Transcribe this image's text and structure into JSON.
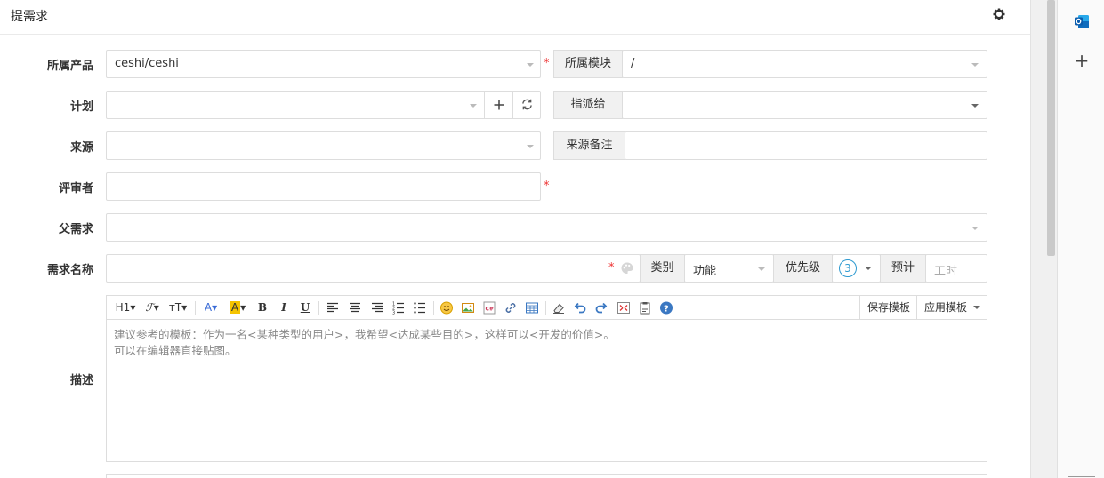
{
  "header": {
    "title": "提需求"
  },
  "form": {
    "product": {
      "label": "所属产品",
      "value": "ceshi/ceshi"
    },
    "module": {
      "label": "所属模块",
      "value": "/"
    },
    "plan": {
      "label": "计划",
      "value": ""
    },
    "assigned": {
      "label": "指派给",
      "value": ""
    },
    "source": {
      "label": "来源",
      "value": ""
    },
    "source_note": {
      "label": "来源备注",
      "value": ""
    },
    "reviewer": {
      "label": "评审者",
      "value": ""
    },
    "parent": {
      "label": "父需求",
      "value": ""
    },
    "name": {
      "label": "需求名称",
      "value": ""
    },
    "category": {
      "label": "类别",
      "value": "功能"
    },
    "priority": {
      "label": "优先级",
      "value": "3"
    },
    "estimate": {
      "label": "预计",
      "placeholder": "工时"
    },
    "required_mark": "*",
    "desc": {
      "label": "描述",
      "placeholder_line1": "建议参考的模板：作为一名<某种类型的用户>，我希望<达成某些目的>，这样可以<开发的价值>。",
      "placeholder_line2": "可以在编辑器直接贴图。"
    }
  },
  "toolbar": {
    "heading": "H1",
    "save_template": "保存模板",
    "apply_template": "应用模板"
  },
  "colors": {
    "required": "#e33333",
    "priority_ring": "#2e9ad0",
    "outlook": "#0f6cbd"
  }
}
